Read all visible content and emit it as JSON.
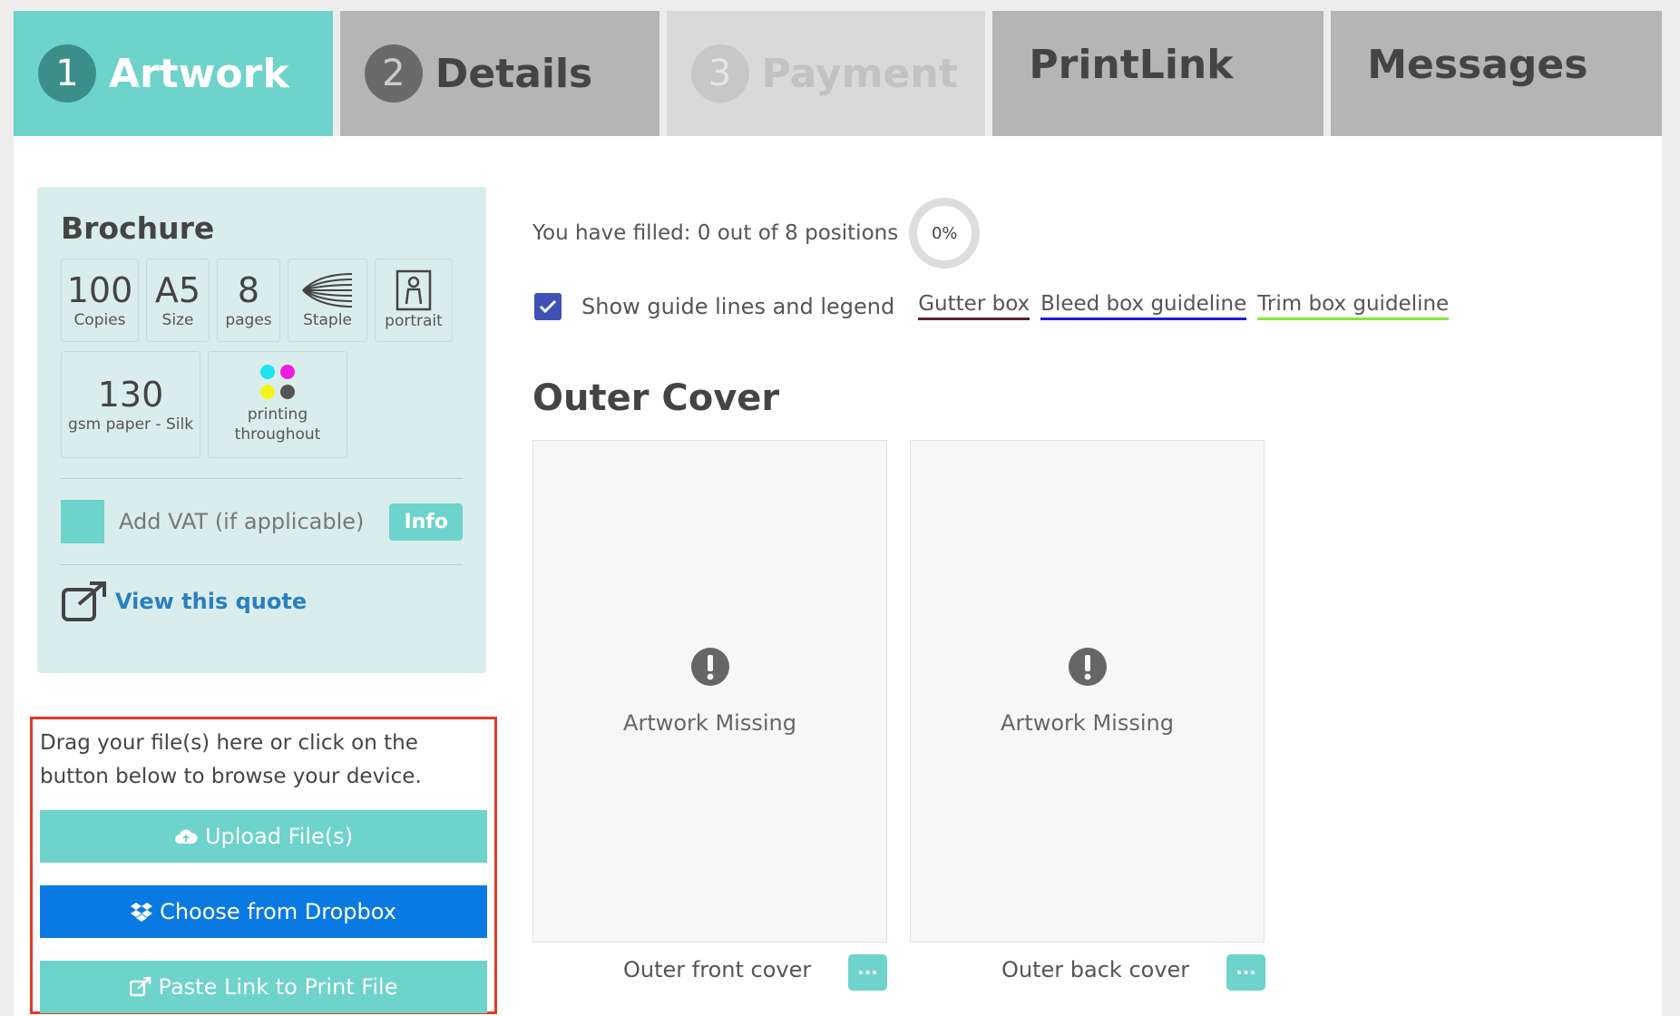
{
  "tabs": [
    {
      "num": "1",
      "label": "Artwork"
    },
    {
      "num": "2",
      "label": "Details"
    },
    {
      "num": "3",
      "label": "Payment"
    },
    {
      "label": "PrintLink"
    },
    {
      "label": "Messages"
    }
  ],
  "quote": {
    "title": "Brochure",
    "specs": [
      {
        "big": "100",
        "small": "Copies"
      },
      {
        "big": "A5",
        "small": "Size"
      },
      {
        "big": "8",
        "small": "pages"
      },
      {
        "small": "Staple",
        "icon": "staple-icon"
      },
      {
        "small": "portrait",
        "icon": "portrait-icon"
      },
      {
        "big": "130",
        "small": "gsm paper - Silk"
      },
      {
        "small": "printing throughout",
        "icon": "cmyk-icon"
      }
    ],
    "cmyk_colors": [
      "#1de3f0",
      "#f01de0",
      "#f5f51a",
      "#555555"
    ],
    "vat_label": "Add VAT (if applicable)",
    "info_label": "Info",
    "view_quote": "View this quote"
  },
  "upload": {
    "text": "Drag your file(s) here or click on the button below to browse your device.",
    "upload_label": "Upload File(s)",
    "dropbox_label": "Choose from Dropbox",
    "link_label": "Paste Link to Print File"
  },
  "progress": {
    "text": "You have filled: 0 out of 8 positions",
    "percent": "0%"
  },
  "guides": {
    "label": "Show guide lines and legend",
    "checked": true,
    "legend": [
      {
        "label": "Gutter box",
        "color": "#5a1f3a"
      },
      {
        "label": "Bleed box guideline",
        "color": "#1c1ce0"
      },
      {
        "label": "Trim box guideline",
        "color": "#84e83a"
      }
    ]
  },
  "section": {
    "title": "Outer Cover",
    "pages": [
      {
        "status": "Artwork Missing",
        "caption": "Outer front cover"
      },
      {
        "status": "Artwork Missing",
        "caption": "Outer back cover"
      }
    ],
    "more_label": "···"
  },
  "colors": {
    "accent": "#6dd3cb",
    "dropbox": "#0a7ae2",
    "highlight_border": "#e03a2a"
  }
}
